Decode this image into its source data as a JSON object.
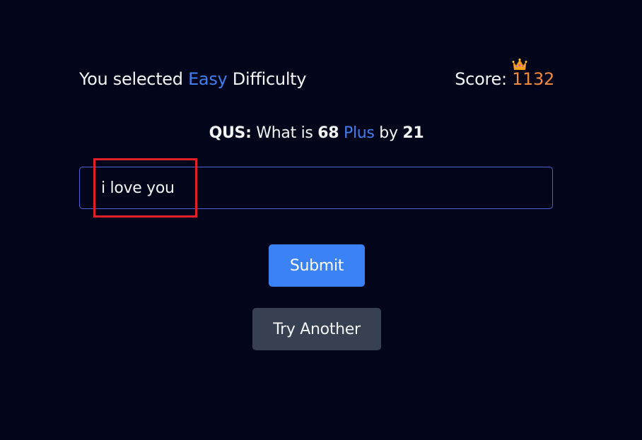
{
  "header": {
    "prefix": "You selected",
    "difficulty": "Easy",
    "suffix": "Difficulty",
    "score_label": "Score:",
    "score_value": "1132",
    "crown_icon": "crown-icon"
  },
  "question": {
    "label": "QUS:",
    "text_before": "What is",
    "operand_a": "68",
    "operation": "Plus",
    "text_middle": "by",
    "operand_b": "21"
  },
  "answer": {
    "value": "i love you",
    "placeholder": ""
  },
  "buttons": {
    "submit": "Submit",
    "try_another": "Try Another"
  },
  "colors": {
    "background": "#03061a",
    "accent_blue": "#3f7ff0",
    "score_orange": "#f0883e",
    "submit_blue": "#3b82f6",
    "secondary_gray": "#374151",
    "highlight_red": "#e3202a"
  }
}
